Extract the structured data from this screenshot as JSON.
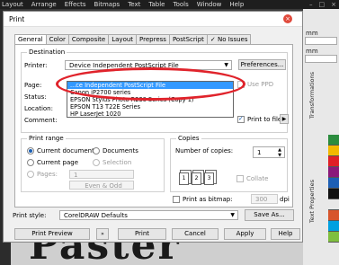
{
  "app": {
    "menu": [
      "Layout",
      "Arrange",
      "Effects",
      "Bitmaps",
      "Text",
      "Table",
      "Tools",
      "Window",
      "Help"
    ],
    "window_controls": [
      "–",
      "□",
      "×"
    ],
    "right_units": [
      "mm",
      "mm"
    ],
    "docker_tabs": [
      "Transformations",
      "Text Properties"
    ],
    "canvas_text": "Paster",
    "palette_colors": [
      "#2b8c3e",
      "#f2b800",
      "#e01f26",
      "#8b1a7a",
      "#1e5fb4",
      "#111111",
      "#e8e8e8",
      "#d7552c",
      "#00a0e0",
      "#7fbf3f"
    ]
  },
  "dialog": {
    "title": "Print",
    "close_icon": "close-icon",
    "tabs": [
      "General",
      "Color",
      "Composite",
      "Layout",
      "Prepress",
      "PostScript",
      "No Issues"
    ],
    "destination": {
      "group_label": "Destination",
      "printer_label": "Printer:",
      "printer_value": "Device Independent PostScript File",
      "preferences_label": "Preferences...",
      "page_label": "Page:",
      "status_label": "Status:",
      "location_label": "Location:",
      "comment_label": "Comment:",
      "use_ppd_label": "Use PPD",
      "print_to_file_label": "Print to file",
      "print_to_file_checked": true,
      "dropdown_items": [
        "...ce Independent PostScript File",
        "Canon iP2700 series",
        "EPSON Stylus Photo R230 Series (Copy 1)",
        "EPSON T13 T22E Series",
        "HP LaserJet 1020"
      ]
    },
    "print_range": {
      "group_label": "Print range",
      "current_document": "Current document",
      "documents": "Documents",
      "current_page": "Current page",
      "selection": "Selection",
      "pages": "Pages:",
      "pages_value": "1",
      "even_odd": "Even & Odd"
    },
    "copies": {
      "group_label": "Copies",
      "number_label": "Number of copies:",
      "number_value": "1",
      "collate_label": "Collate",
      "page_icons": [
        "1",
        "2",
        "3"
      ]
    },
    "print_as_bitmap": {
      "label": "Print as bitmap:",
      "dpi_value": "300",
      "dpi_unit": "dpi"
    },
    "print_style": {
      "label": "Print style:",
      "value": "CorelDRAW Defaults",
      "save_as": "Save As..."
    },
    "footer": {
      "preview": "Print Preview",
      "preview_toggle_icon": "double-chevron-icon",
      "print": "Print",
      "cancel": "Cancel",
      "apply": "Apply",
      "help": "Help"
    }
  }
}
